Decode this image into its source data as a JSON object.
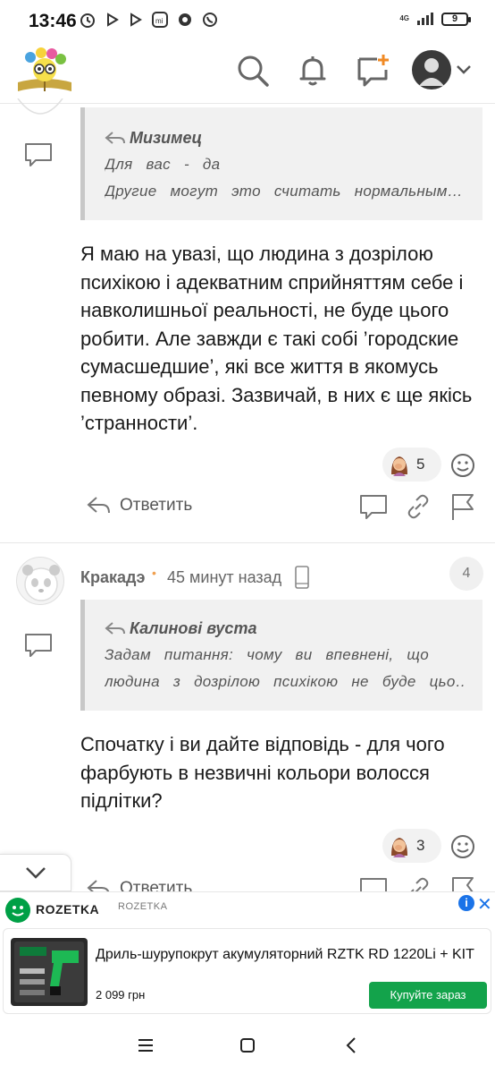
{
  "status_bar": {
    "time": "13:46",
    "network": "4G",
    "battery": "9",
    "icons": [
      "alarm-icon",
      "play-icon",
      "play-icon",
      "mi-icon",
      "app-icon",
      "whatsapp-icon"
    ]
  },
  "header": {
    "icons": [
      "search-icon",
      "bell-icon",
      "new-post-icon",
      "user-avatar",
      "chevron-down-icon"
    ],
    "accent_color": "#f08a24"
  },
  "comment1": {
    "quote_author": "Мизимец",
    "quote_lines": [
      "Для вас - да",
      "Другие могут это считать нормальным…"
    ],
    "body": "Я маю на увазі, що людина з дозрілою психікою і адекватним сприйняттям себе і навколишньої реальності, не буде цього робити. Але завжди є такі собі ’городские сумасшедшие’, які все життя в якомусь певному образі. Зазвичай, в них є ще якісь ’странности’.",
    "reaction_count": "5",
    "reply_label": "Ответить"
  },
  "comment2": {
    "author": "Кракадэ",
    "dot": "•",
    "time": "45 минут назад",
    "number": "4",
    "quote_author": "Калинові вуста",
    "quote_lines": [
      "Задам питання: чому ви впевнені, що",
      "людина з дозрілою психікою не буде цьо…"
    ],
    "body": "Спочатку і ви дайте відповідь - для чого фарбують в незвичні кольори волосся підлітки?",
    "reaction_count": "3",
    "reply_label": "Ответить"
  },
  "ad": {
    "brand": "ROZETKA",
    "brand_small": "ROZETKA",
    "title": "Дриль-шурупокрут акумуляторний RZTK RD 1220Li + KIT",
    "price": "2 099 грн",
    "cta": "Купуйте зараз",
    "info": "i",
    "close": "✕",
    "brand_color": "#00a046",
    "cta_color": "#13a34b"
  }
}
